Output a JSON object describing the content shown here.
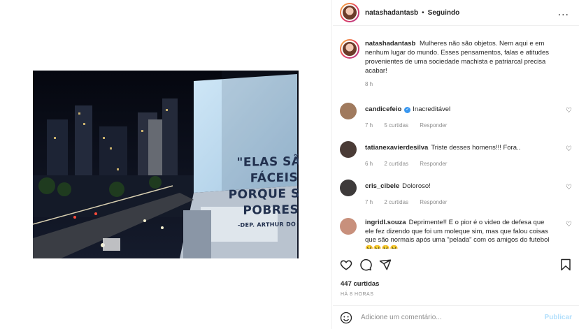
{
  "post_image": {
    "quote": "\"ELAS SÃO FÁCEIS PORQUE SÃO POBRES\"",
    "attribution": "-DEP. ARTHUR DO VAL"
  },
  "header": {
    "username": "natashadantasb",
    "separator": "•",
    "follow_status": "Seguindo",
    "more": "..."
  },
  "caption": {
    "username": "natashadantasb",
    "text": "Mulheres não são objetos. Nem aqui e em nenhum lugar do mundo. Esses pensamentos, falas e atitudes provenientes de uma sociedade machista e patriarcal precisa acabar!",
    "time": "8 h"
  },
  "comments": [
    {
      "username": "candicefeio",
      "verified": true,
      "text": "Inacreditável",
      "time": "7 h",
      "likes": "5 curtidas",
      "reply": "Responder",
      "avatar_color": "#a07a5e"
    },
    {
      "username": "tatianexavierdesilva",
      "verified": false,
      "text": "Triste desses homens!!! Fora..",
      "time": "6 h",
      "likes": "2 curtidas",
      "reply": "Responder",
      "avatar_color": "#4a3b36"
    },
    {
      "username": "cris_cibele",
      "verified": false,
      "text": "Doloroso!",
      "time": "7 h",
      "likes": "2 curtidas",
      "reply": "Responder",
      "avatar_color": "#3d3a3a"
    },
    {
      "username": "ingridl.souza",
      "verified": false,
      "text": "Deprimente!! E o pior é o video de defesa que ele fez dizendo que foi um moleque sim, mas que falou coisas que são normais após uma \"pelada\" com os amigos do futebol 🤮🤮🤮🤮",
      "avatar_color": "#c8907c"
    }
  ],
  "actions": {
    "like_icon": "heart-icon",
    "comment_icon": "comment-icon",
    "share_icon": "share-icon",
    "save_icon": "bookmark-icon"
  },
  "likes_count": "447 curtidas",
  "posted_ago": "HÁ 8 HORAS",
  "add_comment": {
    "placeholder": "Adicione um comentário...",
    "publish": "Publicar"
  },
  "colors": {
    "verified": "#3897f0",
    "publish_disabled": "#b2dffc",
    "muted": "#8e8e8e"
  }
}
